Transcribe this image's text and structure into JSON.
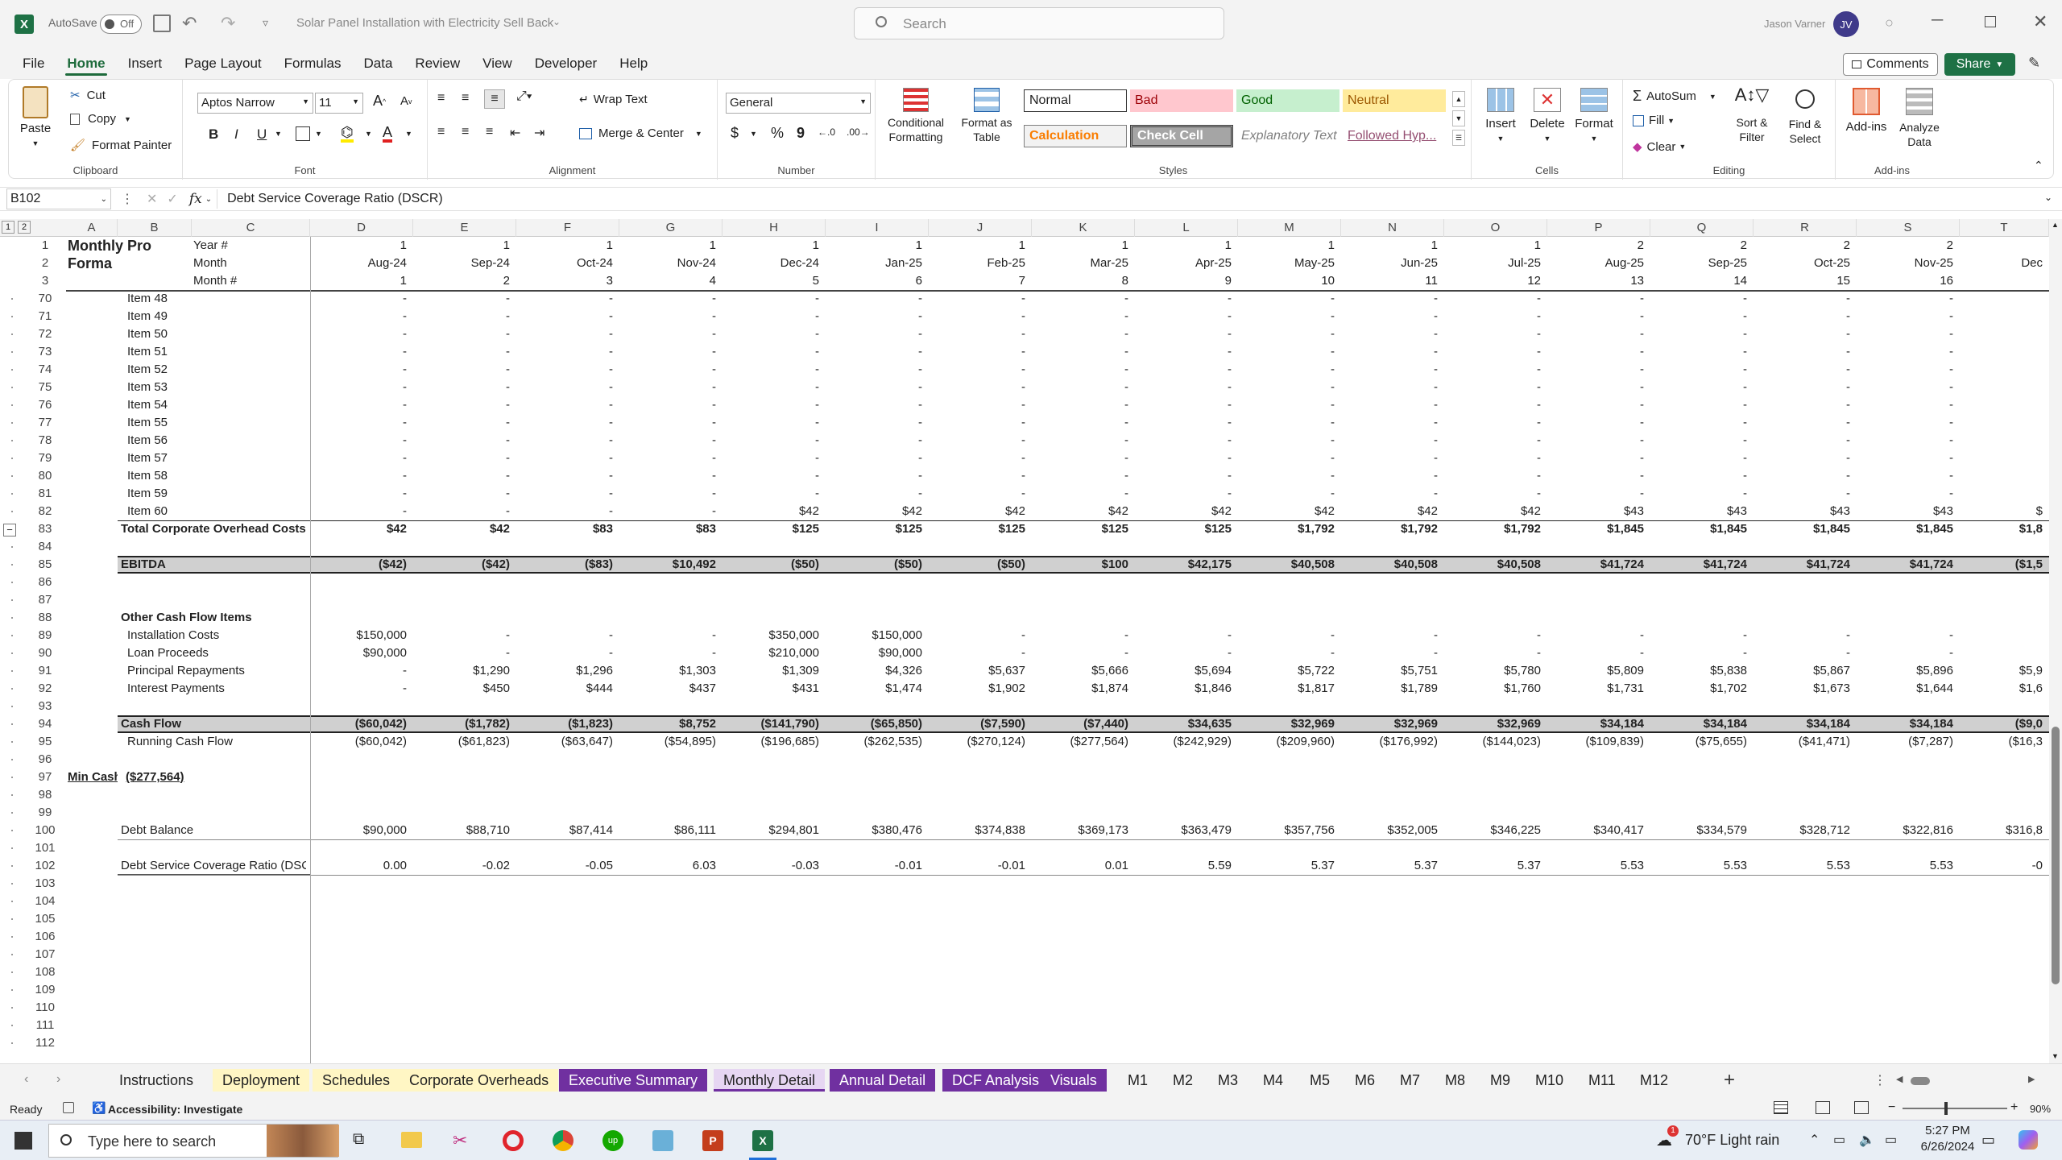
{
  "titlebar": {
    "autosave_label": "AutoSave",
    "autosave_state": "Off",
    "doc_title": "Solar Panel Installation with Electricity Sell Back",
    "search_placeholder": "Search",
    "user_name": "Jason Varner",
    "user_initials": "JV"
  },
  "menu": [
    "File",
    "Home",
    "Insert",
    "Page Layout",
    "Formulas",
    "Data",
    "Review",
    "View",
    "Developer",
    "Help"
  ],
  "menu_active": "Home",
  "actions": {
    "comments": "Comments",
    "share": "Share"
  },
  "ribbon": {
    "clipboard": {
      "paste": "Paste",
      "cut": "Cut",
      "copy": "Copy",
      "format_painter": "Format Painter",
      "label": "Clipboard"
    },
    "font": {
      "name": "Aptos Narrow",
      "size": "11",
      "bold": "B",
      "italic": "I",
      "underline": "U",
      "label": "Font"
    },
    "alignment": {
      "wrap": "Wrap Text",
      "merge": "Merge & Center",
      "label": "Alignment"
    },
    "number": {
      "format": "General",
      "currency": "$",
      "percent": "%",
      "comma": "9",
      "label": "Number"
    },
    "styles": {
      "conditional": "Conditional Formatting",
      "format_table": "Format as Table",
      "normal": "Normal",
      "bad": "Bad",
      "good": "Good",
      "neutral": "Neutral",
      "calculation": "Calculation",
      "check": "Check Cell",
      "explanatory": "Explanatory Text",
      "followed": "Followed Hyp...",
      "label": "Styles"
    },
    "cells": {
      "insert": "Insert",
      "delete": "Delete",
      "format": "Format",
      "label": "Cells"
    },
    "editing": {
      "autosum": "AutoSum",
      "fill": "Fill",
      "clear": "Clear",
      "sort": "Sort & Filter",
      "find": "Find & Select",
      "label": "Editing"
    },
    "addins": {
      "addins": "Add-ins",
      "analyze": "Analyze Data",
      "label": "Add-ins"
    }
  },
  "formula": {
    "cell_ref": "B102",
    "fx": "fx",
    "content": "Debt Service Coverage Ratio (DSCR)"
  },
  "columns": [
    "A",
    "B",
    "C",
    "D",
    "E",
    "F",
    "G",
    "H",
    "I",
    "J",
    "K",
    "L",
    "M",
    "N",
    "O",
    "P",
    "Q",
    "R",
    "S",
    "T"
  ],
  "header_block": {
    "title1": "Monthly Pro",
    "title2": "Forma",
    "labels": [
      "Year #",
      "Month",
      "Month #"
    ],
    "years": [
      "1",
      "1",
      "1",
      "1",
      "1",
      "1",
      "1",
      "1",
      "1",
      "1",
      "1",
      "1",
      "2",
      "2",
      "2",
      "2"
    ],
    "months": [
      "Aug-24",
      "Sep-24",
      "Oct-24",
      "Nov-24",
      "Dec-24",
      "Jan-25",
      "Feb-25",
      "Mar-25",
      "Apr-25",
      "May-25",
      "Jun-25",
      "Jul-25",
      "Aug-25",
      "Sep-25",
      "Oct-25",
      "Nov-25",
      "Dec"
    ],
    "month_nums": [
      "1",
      "2",
      "3",
      "4",
      "5",
      "6",
      "7",
      "8",
      "9",
      "10",
      "11",
      "12",
      "13",
      "14",
      "15",
      "16"
    ]
  },
  "item_rows": [
    {
      "row": "70",
      "label": "Item 48"
    },
    {
      "row": "71",
      "label": "Item 49"
    },
    {
      "row": "72",
      "label": "Item 50"
    },
    {
      "row": "73",
      "label": "Item 51"
    },
    {
      "row": "74",
      "label": "Item 52"
    },
    {
      "row": "75",
      "label": "Item 53"
    },
    {
      "row": "76",
      "label": "Item 54"
    },
    {
      "row": "77",
      "label": "Item 55"
    },
    {
      "row": "78",
      "label": "Item 56"
    },
    {
      "row": "79",
      "label": "Item 57"
    },
    {
      "row": "80",
      "label": "Item 58"
    },
    {
      "row": "81",
      "label": "Item 59"
    }
  ],
  "item60": {
    "row": "82",
    "label": "Item 60",
    "values": [
      "-",
      "-",
      "-",
      "-",
      "$42",
      "$42",
      "$42",
      "$42",
      "$42",
      "$42",
      "$42",
      "$42",
      "$43",
      "$43",
      "$43",
      "$43",
      "$"
    ]
  },
  "total_overhead": {
    "row": "83",
    "label": "Total Corporate Overhead Costs",
    "values": [
      "$42",
      "$42",
      "$83",
      "$83",
      "$125",
      "$125",
      "$125",
      "$125",
      "$125",
      "$1,792",
      "$1,792",
      "$1,792",
      "$1,845",
      "$1,845",
      "$1,845",
      "$1,845",
      "$1,8"
    ]
  },
  "ebitda": {
    "row": "85",
    "label": "EBITDA",
    "values": [
      "($42)",
      "($42)",
      "($83)",
      "$10,492",
      "($50)",
      "($50)",
      "($50)",
      "$100",
      "$42,175",
      "$40,508",
      "$40,508",
      "$40,508",
      "$41,724",
      "$41,724",
      "$41,724",
      "$41,724",
      "($1,5"
    ]
  },
  "other_header": {
    "row": "88",
    "label": "Other Cash Flow Items"
  },
  "other_rows": [
    {
      "row": "89",
      "label": "Installation Costs",
      "values": [
        "$150,000",
        "-",
        "-",
        "-",
        "$350,000",
        "$150,000",
        "-",
        "-",
        "-",
        "-",
        "-",
        "-",
        "-",
        "-",
        "-",
        "-",
        ""
      ]
    },
    {
      "row": "90",
      "label": "Loan Proceeds",
      "values": [
        "$90,000",
        "-",
        "-",
        "-",
        "$210,000",
        "$90,000",
        "-",
        "-",
        "-",
        "-",
        "-",
        "-",
        "-",
        "-",
        "-",
        "-",
        ""
      ]
    },
    {
      "row": "91",
      "label": "Principal Repayments",
      "values": [
        "-",
        "$1,290",
        "$1,296",
        "$1,303",
        "$1,309",
        "$4,326",
        "$5,637",
        "$5,666",
        "$5,694",
        "$5,722",
        "$5,751",
        "$5,780",
        "$5,809",
        "$5,838",
        "$5,867",
        "$5,896",
        "$5,9"
      ]
    },
    {
      "row": "92",
      "label": "Interest Payments",
      "values": [
        "-",
        "$450",
        "$444",
        "$437",
        "$431",
        "$1,474",
        "$1,902",
        "$1,874",
        "$1,846",
        "$1,817",
        "$1,789",
        "$1,760",
        "$1,731",
        "$1,702",
        "$1,673",
        "$1,644",
        "$1,6"
      ]
    }
  ],
  "cash_flow": {
    "row": "94",
    "label": "Cash Flow",
    "values": [
      "($60,042)",
      "($1,782)",
      "($1,823)",
      "$8,752",
      "($141,790)",
      "($65,850)",
      "($7,590)",
      "($7,440)",
      "$34,635",
      "$32,969",
      "$32,969",
      "$32,969",
      "$34,184",
      "$34,184",
      "$34,184",
      "$34,184",
      "($9,0"
    ]
  },
  "running": {
    "row": "95",
    "label": "Running Cash Flow",
    "values": [
      "($60,042)",
      "($61,823)",
      "($63,647)",
      "($54,895)",
      "($196,685)",
      "($262,535)",
      "($270,124)",
      "($277,564)",
      "($242,929)",
      "($209,960)",
      "($176,992)",
      "($144,023)",
      "($109,839)",
      "($75,655)",
      "($41,471)",
      "($7,287)",
      "($16,3"
    ]
  },
  "min_cash": {
    "row": "97",
    "label": "Min Cash",
    "value": "($277,564)"
  },
  "debt_balance": {
    "row": "100",
    "label": "Debt Balance",
    "values": [
      "$90,000",
      "$88,710",
      "$87,414",
      "$86,111",
      "$294,801",
      "$380,476",
      "$374,838",
      "$369,173",
      "$363,479",
      "$357,756",
      "$352,005",
      "$346,225",
      "$340,417",
      "$334,579",
      "$328,712",
      "$322,816",
      "$316,8"
    ]
  },
  "dscr": {
    "row": "102",
    "label": "Debt Service Coverage Ratio (DSCR)",
    "values": [
      "0.00",
      "-0.02",
      "-0.05",
      "6.03",
      "-0.03",
      "-0.01",
      "-0.01",
      "0.01",
      "5.59",
      "5.37",
      "5.37",
      "5.37",
      "5.53",
      "5.53",
      "5.53",
      "5.53",
      "-0"
    ]
  },
  "blank_rows": [
    "84",
    "86",
    "87",
    "93",
    "96",
    "98",
    "99",
    "101",
    "103",
    "104",
    "105",
    "106",
    "107",
    "108",
    "109",
    "110",
    "111",
    "112"
  ],
  "sheet_tabs": [
    {
      "name": "Instructions",
      "color": "#f3f3f3",
      "text": "#222"
    },
    {
      "name": "Deployment",
      "color": "#fff6c4",
      "text": "#222"
    },
    {
      "name": "Schedules",
      "color": "#fff6c4",
      "text": "#222"
    },
    {
      "name": "Corporate Overheads",
      "color": "#fff6c4",
      "text": "#222"
    },
    {
      "name": "Executive Summary",
      "color": "#7030a0",
      "text": "#fff"
    },
    {
      "name": "Monthly Detail",
      "color": "#e6d6f2",
      "text": "#222"
    },
    {
      "name": "Annual Detail",
      "color": "#7030a0",
      "text": "#fff"
    },
    {
      "name": "DCF Analysis",
      "color": "#7030a0",
      "text": "#fff"
    },
    {
      "name": "Visuals",
      "color": "#7030a0",
      "text": "#fff"
    },
    {
      "name": "M1",
      "color": "#f3f3f3",
      "text": "#222"
    },
    {
      "name": "M2",
      "color": "#f3f3f3",
      "text": "#222"
    },
    {
      "name": "M3",
      "color": "#f3f3f3",
      "text": "#222"
    },
    {
      "name": "M4",
      "color": "#f3f3f3",
      "text": "#222"
    },
    {
      "name": "M5",
      "color": "#f3f3f3",
      "text": "#222"
    },
    {
      "name": "M6",
      "color": "#f3f3f3",
      "text": "#222"
    },
    {
      "name": "M7",
      "color": "#f3f3f3",
      "text": "#222"
    },
    {
      "name": "M8",
      "color": "#f3f3f3",
      "text": "#222"
    },
    {
      "name": "M9",
      "color": "#f3f3f3",
      "text": "#222"
    },
    {
      "name": "M10",
      "color": "#f3f3f3",
      "text": "#222"
    },
    {
      "name": "M11",
      "color": "#f3f3f3",
      "text": "#222"
    },
    {
      "name": "M12",
      "color": "#f3f3f3",
      "text": "#222"
    }
  ],
  "status": {
    "ready": "Ready",
    "accessibility": "Accessibility: Investigate",
    "zoom": "90%"
  },
  "taskbar": {
    "search": "Type here to search",
    "weather": "70°F  Light rain",
    "time": "5:27 PM",
    "date": "6/26/2024",
    "notif": "1"
  }
}
